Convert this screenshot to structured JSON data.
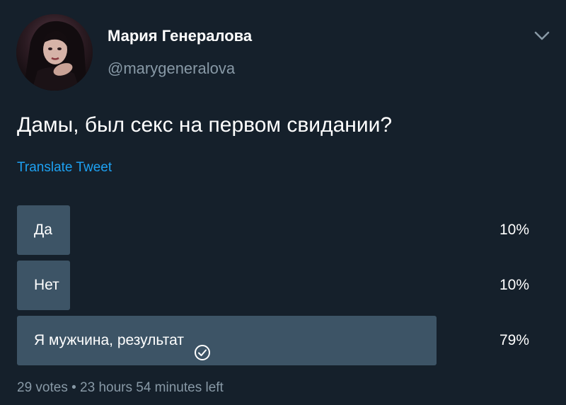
{
  "author": {
    "name": "Мария Генералова",
    "handle": "@marygeneralova"
  },
  "tweet": {
    "text": "Дамы, был секс на первом свидании?",
    "translate_label": "Translate Tweet"
  },
  "poll": {
    "options": [
      {
        "label": "Да",
        "percent": "10%",
        "fraction": 0.1,
        "selected": false
      },
      {
        "label": "Нет",
        "percent": "10%",
        "fraction": 0.1,
        "selected": false
      },
      {
        "label": "Я мужчина, результат",
        "percent": "79%",
        "fraction": 0.79,
        "selected": true
      }
    ],
    "votes": "29 votes",
    "separator": "•",
    "time_left": "23 hours 54 minutes left"
  },
  "icons": {
    "menu": "chevron-down-icon",
    "selected": "check-circle-icon"
  },
  "colors": {
    "background": "#15202b",
    "poll_fill": "#3d5466",
    "link": "#1da1f2",
    "secondary_text": "#8899a6"
  }
}
